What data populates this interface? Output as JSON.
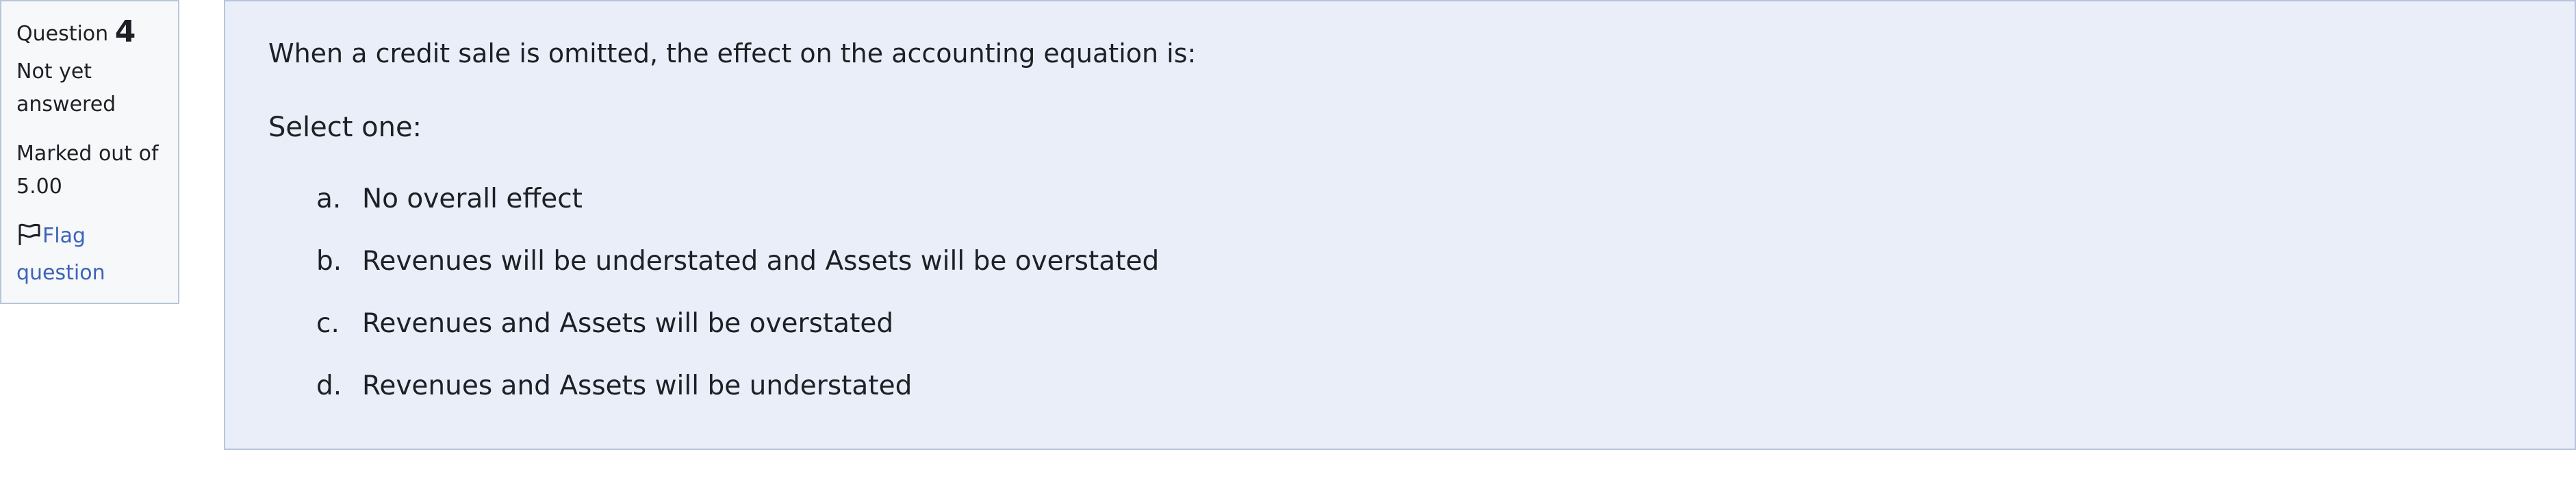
{
  "info": {
    "question_label": "Question",
    "question_number": "4",
    "state_line1": "Not yet",
    "state_line2": "answered",
    "grade_line1": "Marked out of",
    "grade_line2": "5.00",
    "flag_line1": "Flag",
    "flag_line2": "question",
    "flag_icon": "flag-icon"
  },
  "question": {
    "text": "When a credit sale is omitted, the effect on the accounting equation is:",
    "prompt": "Select one:",
    "answers": [
      {
        "letter": "a.",
        "text": "No overall effect"
      },
      {
        "letter": "b.",
        "text": "Revenues will be understated and Assets will be overstated"
      },
      {
        "letter": "c.",
        "text": "Revenues and Assets will be overstated"
      },
      {
        "letter": "d.",
        "text": "Revenues and Assets will be understated"
      }
    ]
  },
  "colors": {
    "content_bg": "#e9eef8",
    "info_bg": "#f7f8fa",
    "border": "#b8c4dc",
    "link": "#3c64b9"
  }
}
